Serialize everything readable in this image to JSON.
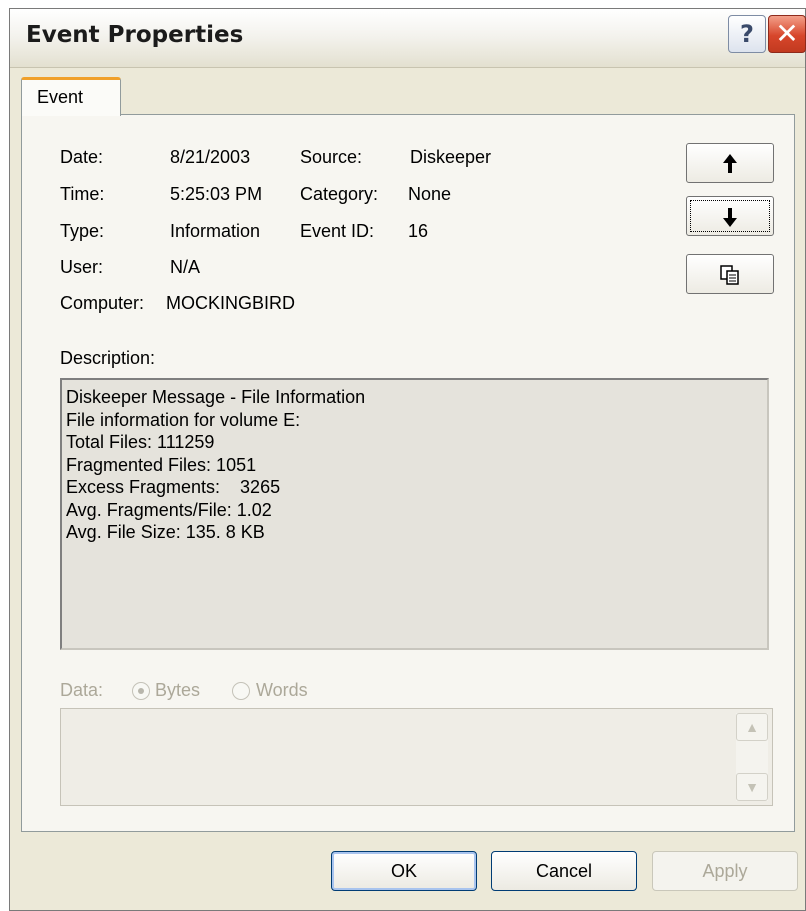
{
  "window": {
    "title": "Event Properties",
    "help_glyph": "?",
    "close_glyph": "✕"
  },
  "tabs": [
    {
      "label": "Event",
      "selected": true
    }
  ],
  "fields": {
    "date_label": "Date:",
    "date_value": "8/21/2003",
    "time_label": "Time:",
    "time_value": "5:25:03 PM",
    "type_label": "Type:",
    "type_value": "Information",
    "user_label": "User:",
    "user_value": "N/A",
    "computer_label": "Computer:",
    "computer_value": "MOCKINGBIRD",
    "source_label": "Source:",
    "source_value": "Diskeeper",
    "category_label": "Category:",
    "category_value": "None",
    "eventid_label": "Event ID:",
    "eventid_value": "16"
  },
  "nav": {
    "up_icon": "up-arrow-icon",
    "down_icon": "down-arrow-icon",
    "copy_icon": "copy-icon"
  },
  "description": {
    "label": "Description:",
    "lines": [
      "Diskeeper Message - File Information",
      "File information for volume E:",
      "Total Files: 111259",
      "Fragmented Files: 1051",
      "Excess Fragments:    3265",
      "Avg. Fragments/File: 1.02",
      "Avg. File Size: 135. 8 KB"
    ]
  },
  "data_section": {
    "label": "Data:",
    "options": [
      {
        "label": "Bytes",
        "selected": true
      },
      {
        "label": "Words",
        "selected": false
      }
    ]
  },
  "buttons": {
    "ok": "OK",
    "cancel": "Cancel",
    "apply": "Apply"
  },
  "colors": {
    "dialog_bg": "#ECE9D8",
    "tab_accent": "#F0A02A",
    "close_red": "#D7462B"
  }
}
